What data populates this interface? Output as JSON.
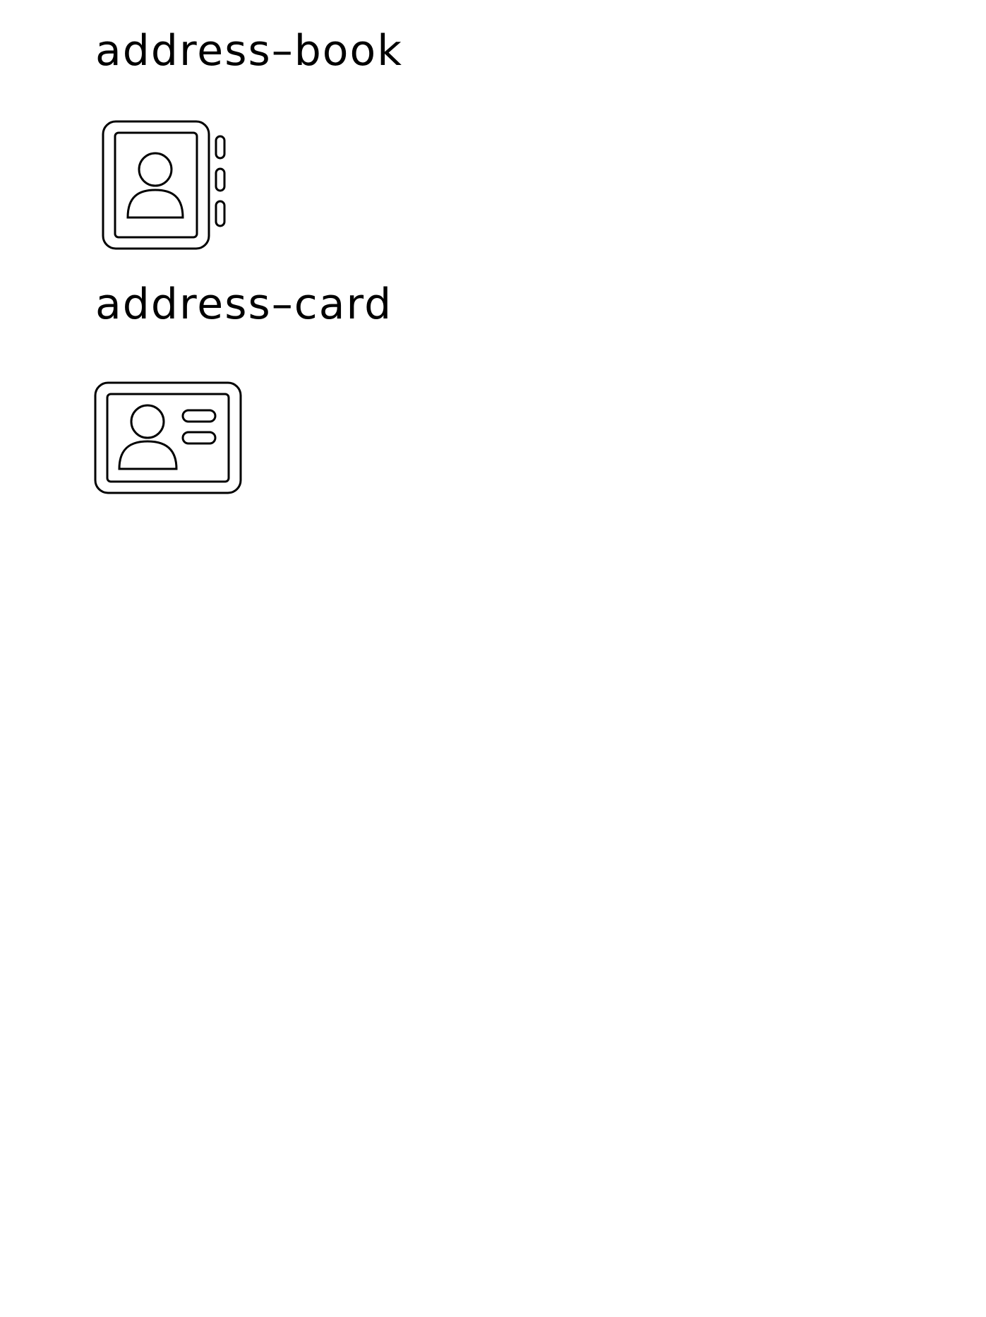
{
  "icons": [
    {
      "label": "address–book",
      "icon": "address-book-icon"
    },
    {
      "label": "address–card",
      "icon": "address-card-icon"
    }
  ],
  "colors": {
    "background": "#ffffff",
    "stroke": "#000000"
  }
}
